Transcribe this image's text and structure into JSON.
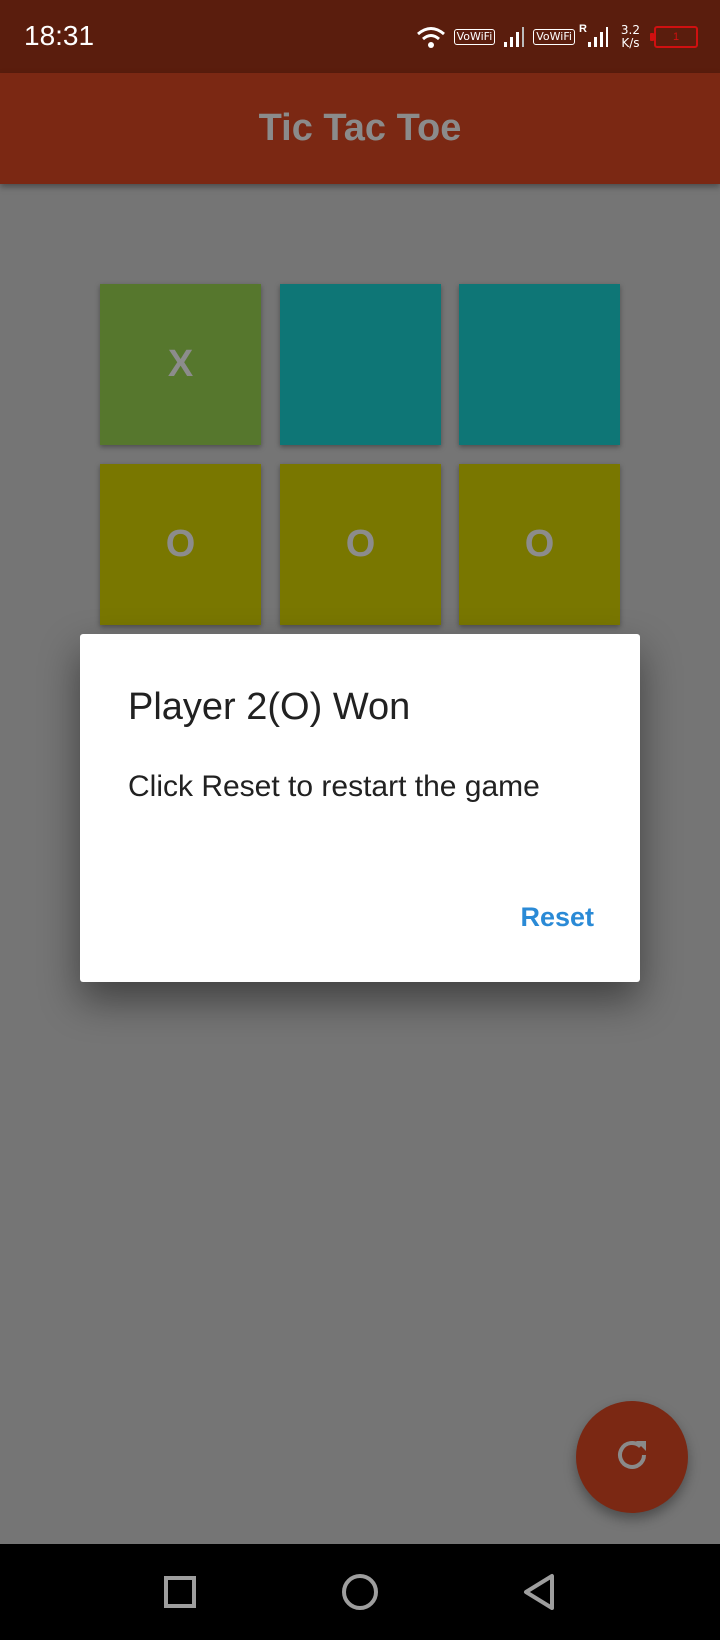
{
  "status_bar": {
    "time": "18:31",
    "vowifi_1": "VoWiFi",
    "vowifi_2": "VoWiFi",
    "roaming": "R",
    "net_speed_value": "3.2",
    "net_speed_unit": "K/s",
    "battery_level": "1"
  },
  "app_bar": {
    "title": "Tic Tac Toe"
  },
  "board": {
    "cells": [
      "X",
      "",
      "",
      "O",
      "O",
      "O"
    ]
  },
  "dialog": {
    "title": "Player 2(O) Won",
    "message": "Click Reset to restart the game",
    "reset_label": "Reset"
  },
  "colors": {
    "status_bar": "#5a1d0d",
    "app_bar": "#7b2813",
    "cell_x": "#56772d",
    "cell_empty": "#0e7676",
    "cell_o": "#797700",
    "dialog_action": "#2a8ad6",
    "fab": "#7b2813"
  },
  "icons": {
    "fab": "refresh-icon",
    "nav_recents": "square-icon",
    "nav_home": "circle-icon",
    "nav_back": "triangle-back-icon"
  }
}
